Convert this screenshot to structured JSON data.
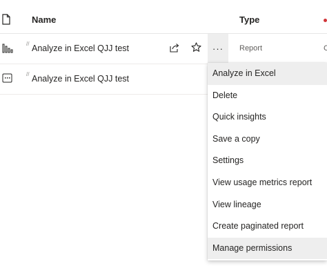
{
  "header": {
    "name_label": "Name",
    "type_label": "Type",
    "file_icon": "document-icon"
  },
  "rows": [
    {
      "icon": "report-bars-icon",
      "name": "Analyze in Excel QJJ test",
      "share_icon": "share-icon",
      "favorite_icon": "star-icon",
      "more_label": "···",
      "type": "Report",
      "edge_text": "C"
    },
    {
      "icon": "dataset-icon",
      "name": "Analyze in Excel QJJ test"
    }
  ],
  "context_menu": {
    "items": [
      "Analyze in Excel",
      "Delete",
      "Quick insights",
      "Save a copy",
      "Settings",
      "View usage metrics report",
      "View lineage",
      "Create paginated report",
      "Manage permissions"
    ],
    "highlight_color": "#eeeeee"
  }
}
